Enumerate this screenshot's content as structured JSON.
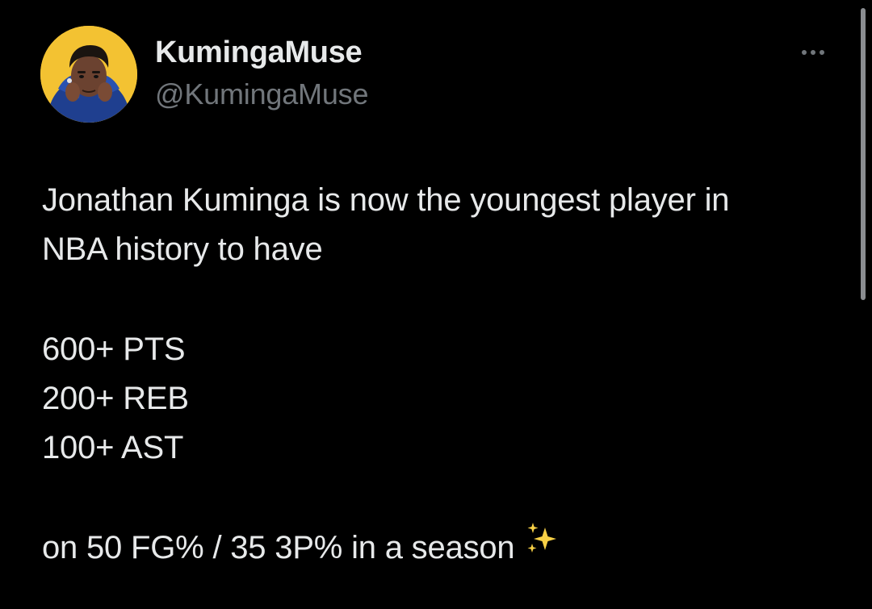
{
  "user": {
    "display_name": "KumingaMuse",
    "handle": "@KumingaMuse",
    "avatar": "cartoon-avatar-icon"
  },
  "menu": {
    "icon": "more-horizontal-icon"
  },
  "tweet": {
    "intro_line1": "Jonathan Kuminga is now the youngest player in",
    "intro_line2": "NBA history to have",
    "stat1": "600+ PTS",
    "stat2": "200+ REB",
    "stat3": "100+ AST",
    "closing": "on 50 FG% / 35 3P% in a season",
    "emoji": "sparkles-icon"
  },
  "colors": {
    "background": "#000000",
    "text_primary": "#e7e9ea",
    "text_secondary": "#71767b",
    "avatar_bg": "#f3c232",
    "sparkle": "#f7d046"
  }
}
